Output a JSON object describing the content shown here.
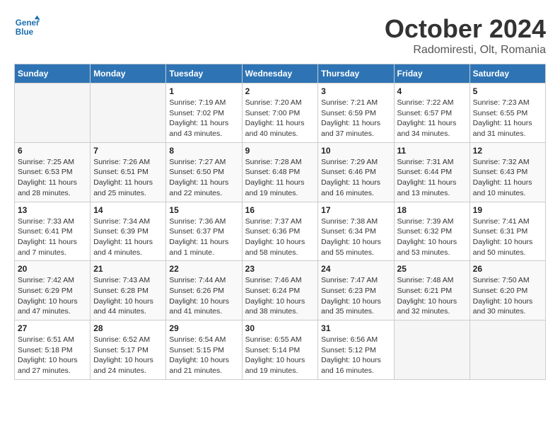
{
  "header": {
    "logo_line1": "General",
    "logo_line2": "Blue",
    "title": "October 2024",
    "subtitle": "Radomiresti, Olt, Romania"
  },
  "weekdays": [
    "Sunday",
    "Monday",
    "Tuesday",
    "Wednesday",
    "Thursday",
    "Friday",
    "Saturday"
  ],
  "weeks": [
    [
      {
        "day": "",
        "info": ""
      },
      {
        "day": "",
        "info": ""
      },
      {
        "day": "1",
        "info": "Sunrise: 7:19 AM\nSunset: 7:02 PM\nDaylight: 11 hours and 43 minutes."
      },
      {
        "day": "2",
        "info": "Sunrise: 7:20 AM\nSunset: 7:00 PM\nDaylight: 11 hours and 40 minutes."
      },
      {
        "day": "3",
        "info": "Sunrise: 7:21 AM\nSunset: 6:59 PM\nDaylight: 11 hours and 37 minutes."
      },
      {
        "day": "4",
        "info": "Sunrise: 7:22 AM\nSunset: 6:57 PM\nDaylight: 11 hours and 34 minutes."
      },
      {
        "day": "5",
        "info": "Sunrise: 7:23 AM\nSunset: 6:55 PM\nDaylight: 11 hours and 31 minutes."
      }
    ],
    [
      {
        "day": "6",
        "info": "Sunrise: 7:25 AM\nSunset: 6:53 PM\nDaylight: 11 hours and 28 minutes."
      },
      {
        "day": "7",
        "info": "Sunrise: 7:26 AM\nSunset: 6:51 PM\nDaylight: 11 hours and 25 minutes."
      },
      {
        "day": "8",
        "info": "Sunrise: 7:27 AM\nSunset: 6:50 PM\nDaylight: 11 hours and 22 minutes."
      },
      {
        "day": "9",
        "info": "Sunrise: 7:28 AM\nSunset: 6:48 PM\nDaylight: 11 hours and 19 minutes."
      },
      {
        "day": "10",
        "info": "Sunrise: 7:29 AM\nSunset: 6:46 PM\nDaylight: 11 hours and 16 minutes."
      },
      {
        "day": "11",
        "info": "Sunrise: 7:31 AM\nSunset: 6:44 PM\nDaylight: 11 hours and 13 minutes."
      },
      {
        "day": "12",
        "info": "Sunrise: 7:32 AM\nSunset: 6:43 PM\nDaylight: 11 hours and 10 minutes."
      }
    ],
    [
      {
        "day": "13",
        "info": "Sunrise: 7:33 AM\nSunset: 6:41 PM\nDaylight: 11 hours and 7 minutes."
      },
      {
        "day": "14",
        "info": "Sunrise: 7:34 AM\nSunset: 6:39 PM\nDaylight: 11 hours and 4 minutes."
      },
      {
        "day": "15",
        "info": "Sunrise: 7:36 AM\nSunset: 6:37 PM\nDaylight: 11 hours and 1 minute."
      },
      {
        "day": "16",
        "info": "Sunrise: 7:37 AM\nSunset: 6:36 PM\nDaylight: 10 hours and 58 minutes."
      },
      {
        "day": "17",
        "info": "Sunrise: 7:38 AM\nSunset: 6:34 PM\nDaylight: 10 hours and 55 minutes."
      },
      {
        "day": "18",
        "info": "Sunrise: 7:39 AM\nSunset: 6:32 PM\nDaylight: 10 hours and 53 minutes."
      },
      {
        "day": "19",
        "info": "Sunrise: 7:41 AM\nSunset: 6:31 PM\nDaylight: 10 hours and 50 minutes."
      }
    ],
    [
      {
        "day": "20",
        "info": "Sunrise: 7:42 AM\nSunset: 6:29 PM\nDaylight: 10 hours and 47 minutes."
      },
      {
        "day": "21",
        "info": "Sunrise: 7:43 AM\nSunset: 6:28 PM\nDaylight: 10 hours and 44 minutes."
      },
      {
        "day": "22",
        "info": "Sunrise: 7:44 AM\nSunset: 6:26 PM\nDaylight: 10 hours and 41 minutes."
      },
      {
        "day": "23",
        "info": "Sunrise: 7:46 AM\nSunset: 6:24 PM\nDaylight: 10 hours and 38 minutes."
      },
      {
        "day": "24",
        "info": "Sunrise: 7:47 AM\nSunset: 6:23 PM\nDaylight: 10 hours and 35 minutes."
      },
      {
        "day": "25",
        "info": "Sunrise: 7:48 AM\nSunset: 6:21 PM\nDaylight: 10 hours and 32 minutes."
      },
      {
        "day": "26",
        "info": "Sunrise: 7:50 AM\nSunset: 6:20 PM\nDaylight: 10 hours and 30 minutes."
      }
    ],
    [
      {
        "day": "27",
        "info": "Sunrise: 6:51 AM\nSunset: 5:18 PM\nDaylight: 10 hours and 27 minutes."
      },
      {
        "day": "28",
        "info": "Sunrise: 6:52 AM\nSunset: 5:17 PM\nDaylight: 10 hours and 24 minutes."
      },
      {
        "day": "29",
        "info": "Sunrise: 6:54 AM\nSunset: 5:15 PM\nDaylight: 10 hours and 21 minutes."
      },
      {
        "day": "30",
        "info": "Sunrise: 6:55 AM\nSunset: 5:14 PM\nDaylight: 10 hours and 19 minutes."
      },
      {
        "day": "31",
        "info": "Sunrise: 6:56 AM\nSunset: 5:12 PM\nDaylight: 10 hours and 16 minutes."
      },
      {
        "day": "",
        "info": ""
      },
      {
        "day": "",
        "info": ""
      }
    ]
  ]
}
